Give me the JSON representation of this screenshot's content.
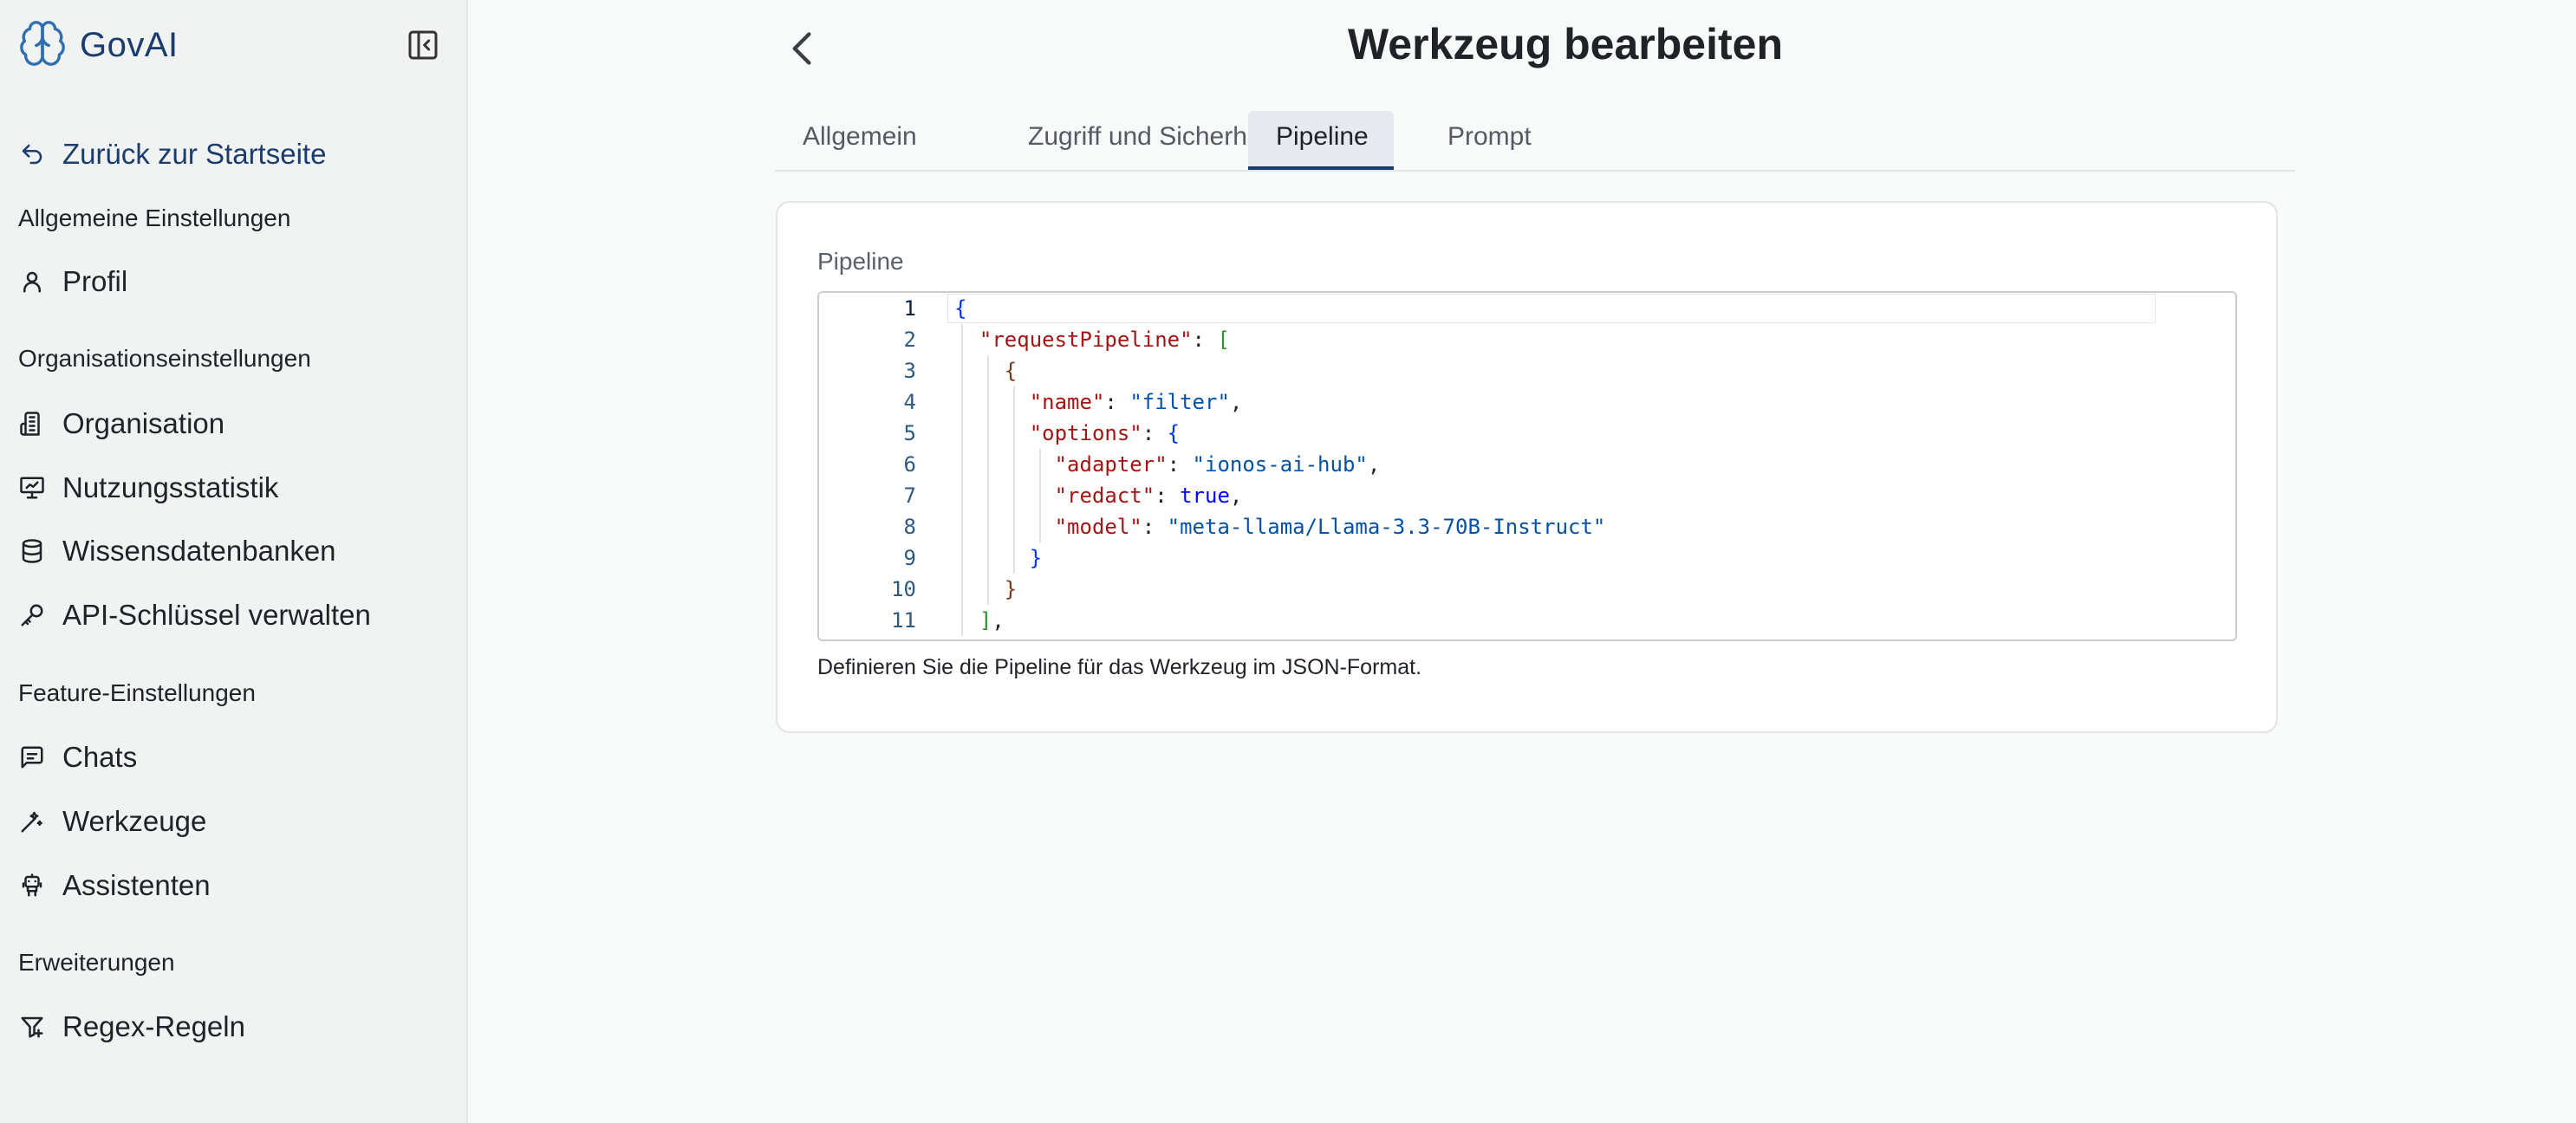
{
  "app": {
    "name": "GovAI"
  },
  "sidebar": {
    "back_label": "Zurück zur Startseite",
    "sections": {
      "general": "Allgemeine Einstellungen",
      "organization": "Organisationseinstellungen",
      "features": "Feature-Einstellungen",
      "extensions": "Erweiterungen"
    },
    "items": {
      "profile": "Profil",
      "organisation": "Organisation",
      "usage": "Nutzungsstatistik",
      "knowledge": "Wissensdatenbanken",
      "api_keys": "API-Schlüssel verwalten",
      "chats": "Chats",
      "tools": "Werkzeuge",
      "assistants": "Assistenten",
      "regex": "Regex-Regeln"
    }
  },
  "page": {
    "title": "Werkzeug bearbeiten"
  },
  "tabs": [
    "Allgemein",
    "Zugriff und Sicherheit",
    "Pipeline",
    "Prompt"
  ],
  "active_tab": "Pipeline",
  "pipeline": {
    "label": "Pipeline",
    "help_text": "Definieren Sie die Pipeline für das Werkzeug im JSON-Format.",
    "line_numbers": [
      "1",
      "2",
      "3",
      "4",
      "5",
      "6",
      "7",
      "8",
      "9",
      "10",
      "11"
    ],
    "code": {
      "open_brace": "{",
      "request_pipeline_key": "\"requestPipeline\"",
      "open_bracket": "[",
      "obj_open": "{",
      "name_key": "\"name\"",
      "name_value": "\"filter\"",
      "options_key": "\"options\"",
      "options_open": "{",
      "adapter_key": "\"adapter\"",
      "adapter_value": "\"ionos-ai-hub\"",
      "redact_key": "\"redact\"",
      "redact_value": "true",
      "model_key": "\"model\"",
      "model_value": "\"meta-llama/Llama-3.3-70B-Instruct\"",
      "options_close": "}",
      "obj_close": "}",
      "close_bracket": "]"
    }
  },
  "colors": {
    "brand": "#1a3d6e",
    "sidebar_bg": "#f1f2f2",
    "page_bg": "#f8f9f9"
  }
}
